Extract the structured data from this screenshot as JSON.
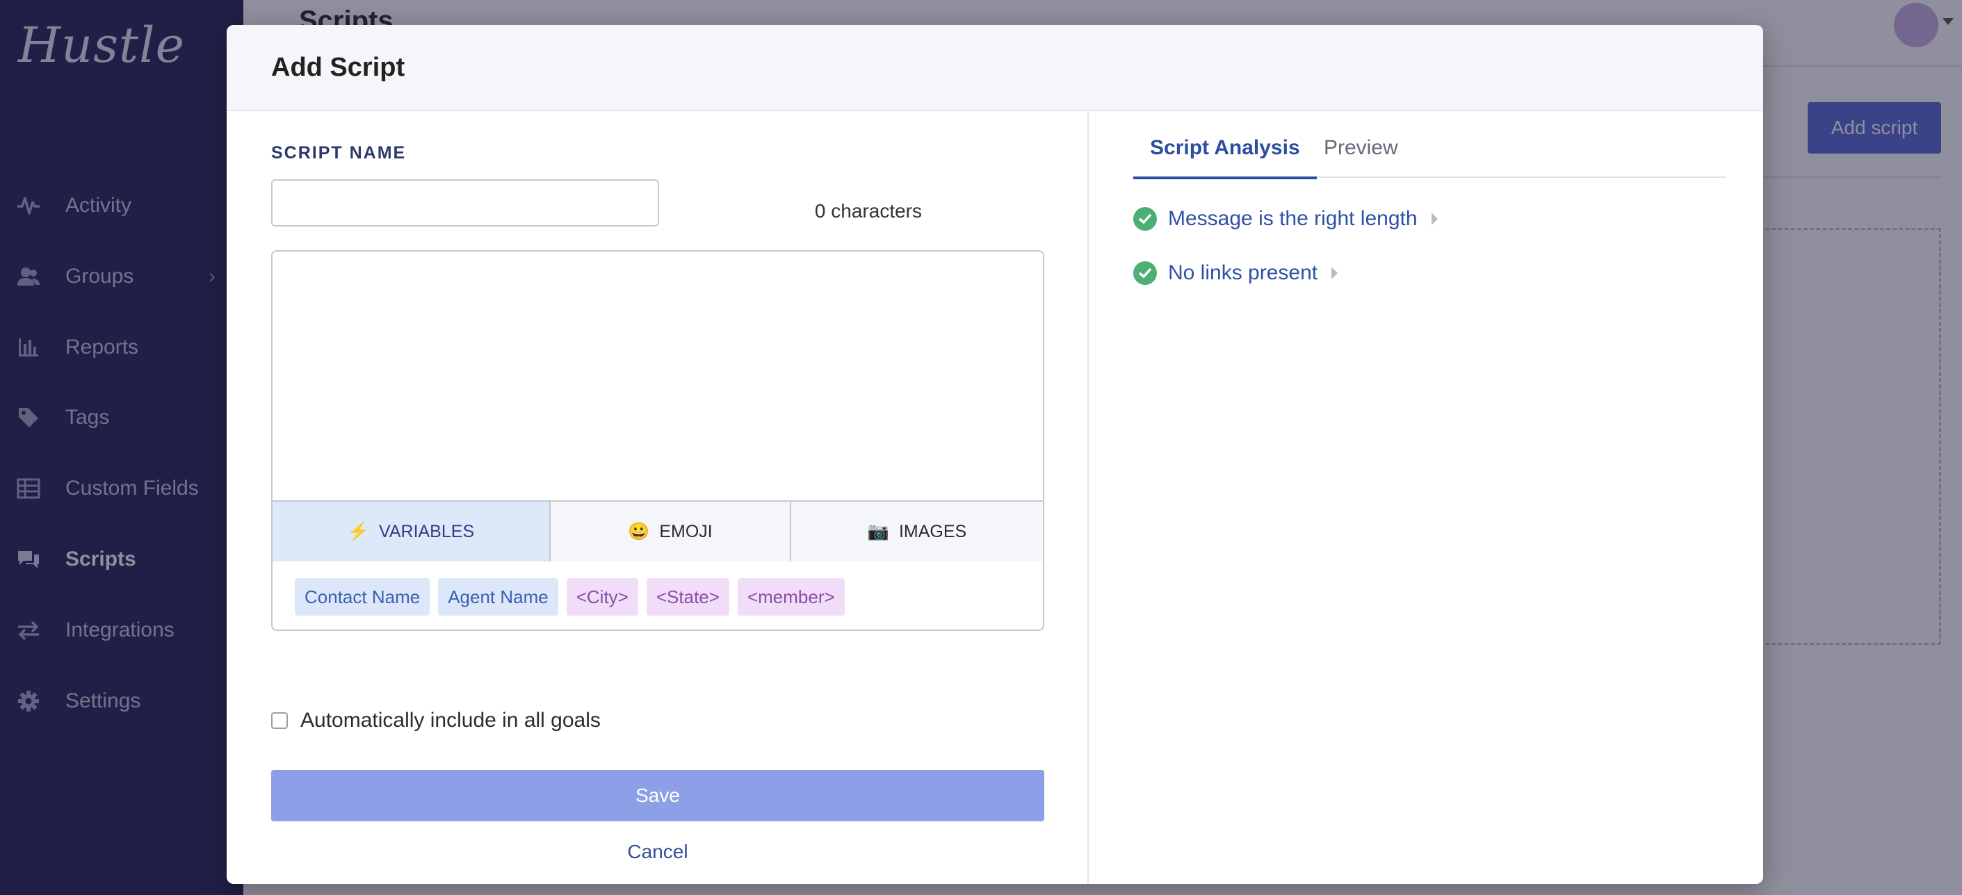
{
  "app": {
    "logo": "Hustle"
  },
  "sidebar": {
    "items": [
      {
        "label": "Activity",
        "icon": "pulse-icon",
        "active": false
      },
      {
        "label": "Groups",
        "icon": "users-icon",
        "active": false
      },
      {
        "label": "Reports",
        "icon": "bar-chart-icon",
        "active": false
      },
      {
        "label": "Tags",
        "icon": "tag-icon",
        "active": false
      },
      {
        "label": "Custom Fields",
        "icon": "table-icon",
        "active": false
      },
      {
        "label": "Scripts",
        "icon": "chat-icon",
        "active": true
      },
      {
        "label": "Integrations",
        "icon": "arrows-icon",
        "active": false
      },
      {
        "label": "Settings",
        "icon": "gear-icon",
        "active": false
      }
    ],
    "groups_chevron": "›"
  },
  "main": {
    "page_title": "Scripts",
    "add_button": "Add script"
  },
  "modal": {
    "title": "Add Script",
    "field_label": "SCRIPT NAME",
    "name_value": "",
    "char_count": "0 characters",
    "message_value": "",
    "editor_tabs": [
      {
        "label": "VARIABLES",
        "icon": "⚡",
        "active": true
      },
      {
        "label": "EMOJI",
        "icon": "😀",
        "active": false
      },
      {
        "label": "IMAGES",
        "icon": "📷",
        "active": false
      }
    ],
    "chips": [
      {
        "label": "Contact Name",
        "style": "blue"
      },
      {
        "label": "Agent Name",
        "style": "blue"
      },
      {
        "label": "<City>",
        "style": "purple"
      },
      {
        "label": "<State>",
        "style": "purple"
      },
      {
        "label": "<member>",
        "style": "purple"
      }
    ],
    "auto_include_label": "Automatically include in all goals",
    "auto_include_checked": false,
    "save_label": "Save",
    "cancel_label": "Cancel",
    "analysis_tabs": [
      {
        "label": "Script Analysis",
        "active": true
      },
      {
        "label": "Preview",
        "active": false
      }
    ],
    "checks": [
      {
        "label": "Message is the right length",
        "status": "pass"
      },
      {
        "label": "No links present",
        "status": "pass"
      }
    ]
  },
  "colors": {
    "sidebar": "#2b2a5a",
    "accent": "#5a6bd6",
    "save_disabled": "#8d9fe6",
    "success": "#4caf73",
    "link": "#2d51a6"
  }
}
